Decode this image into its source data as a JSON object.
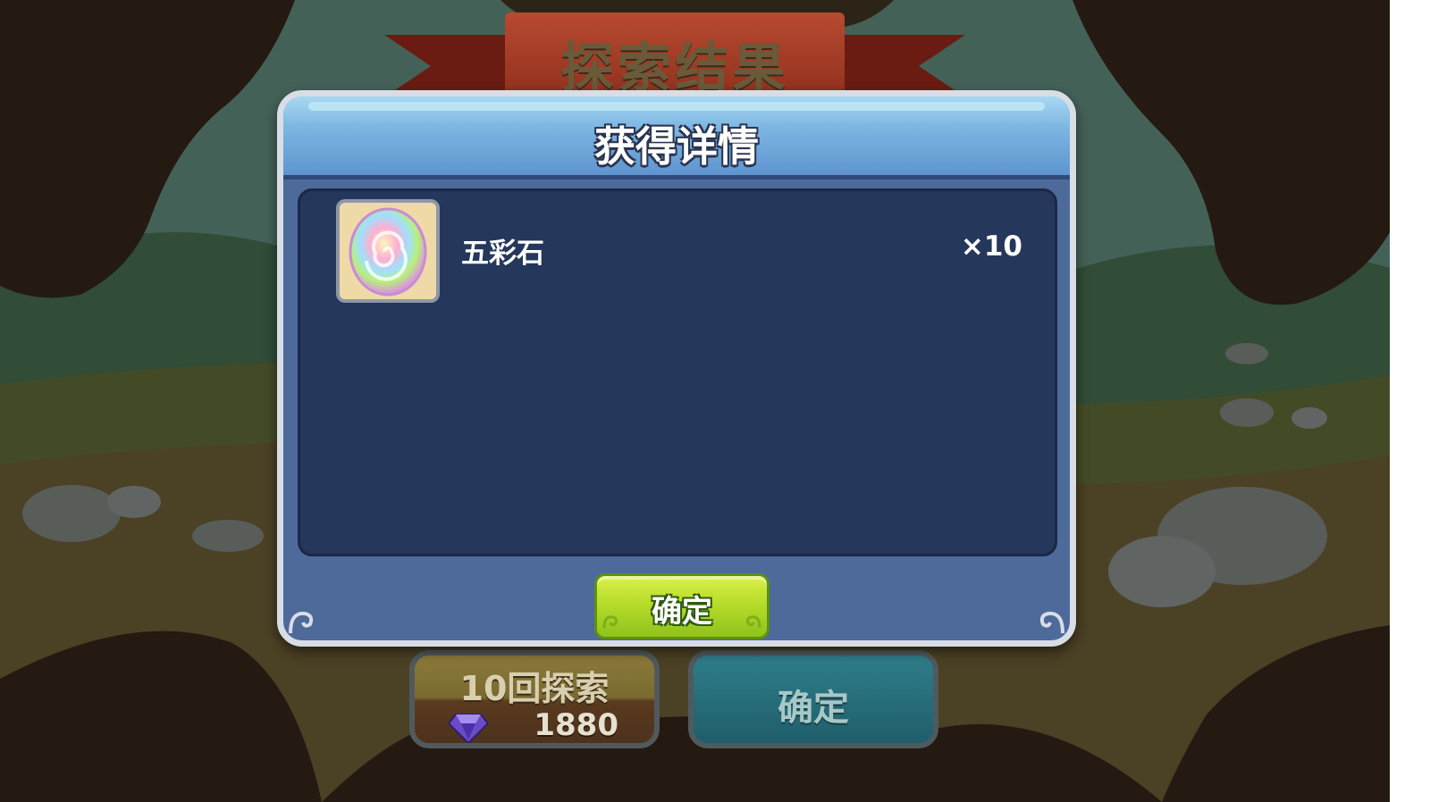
{
  "banner": {
    "title": "探索结果"
  },
  "dialog": {
    "title": "获得详情",
    "rewards": [
      {
        "name": "五彩石",
        "quantity": "×10",
        "icon": "rainbow-stone-icon"
      }
    ],
    "confirm_label": "确定"
  },
  "bottom_bar": {
    "explore_label": "10回探索",
    "explore_cost": "1880",
    "cost_icon": "gem-icon",
    "confirm_label": "确定"
  },
  "colors": {
    "dialog_body": "#4d6a9a",
    "panel": "#26375c",
    "confirm_green": "#b7dc2a",
    "header_blue": "#7cb6e2"
  }
}
